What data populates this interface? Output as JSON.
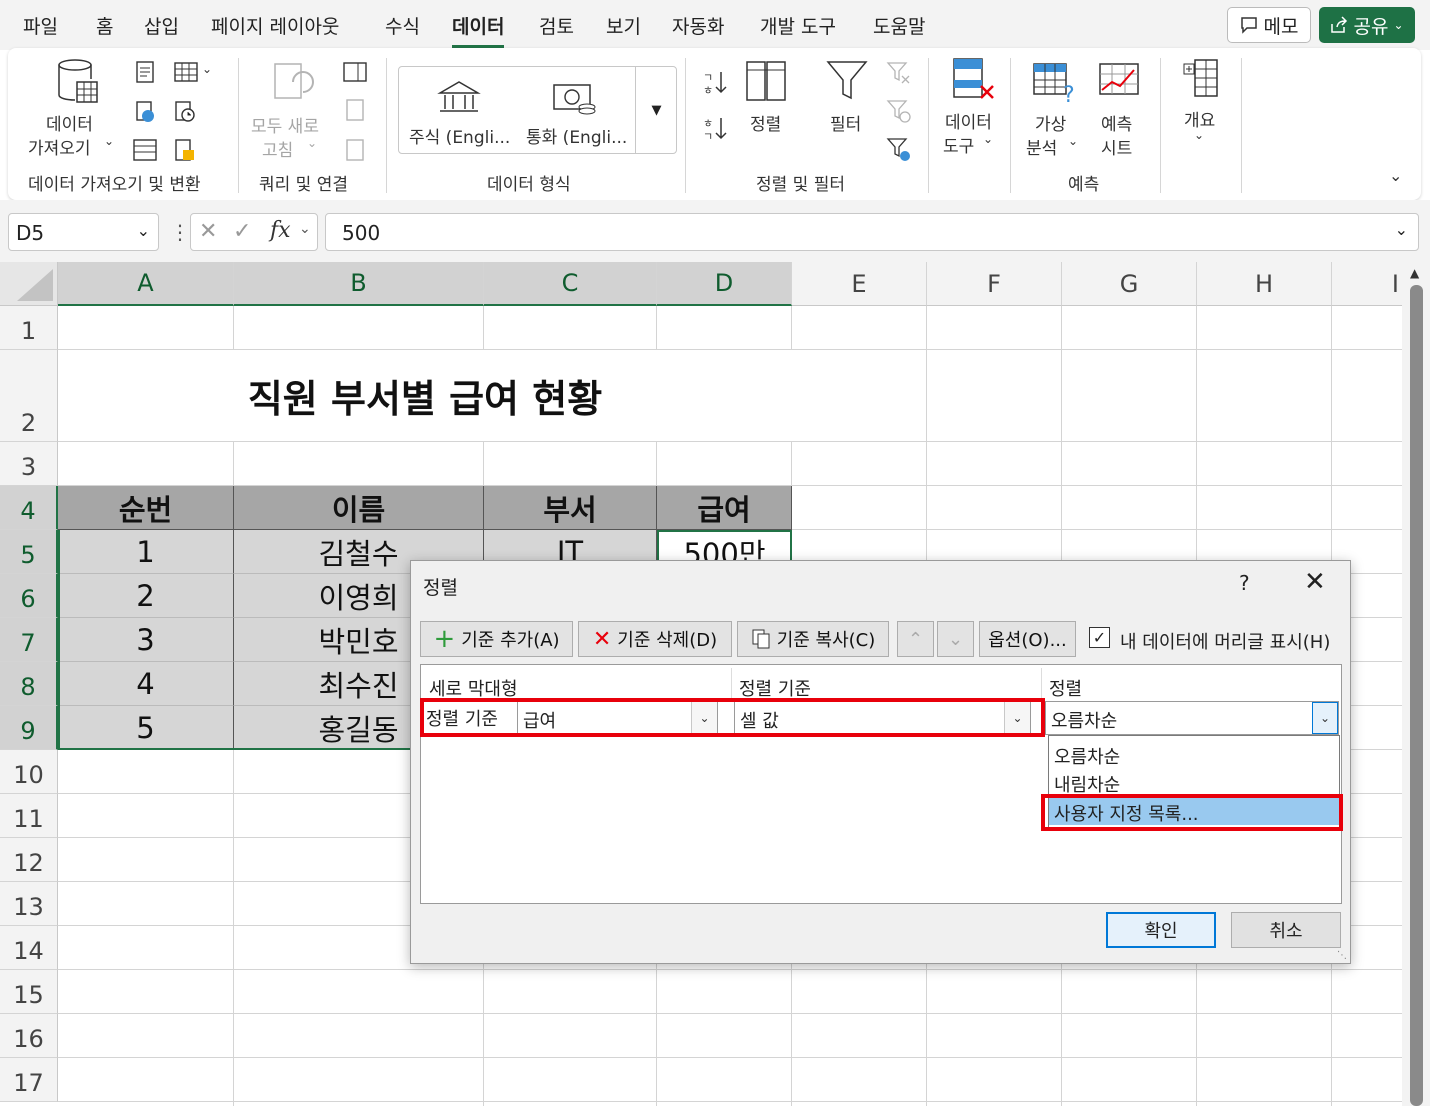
{
  "menu": {
    "tabs": [
      "파일",
      "홈",
      "삽입",
      "페이지 레이아웃",
      "수식",
      "데이터",
      "검토",
      "보기",
      "자동화",
      "개발 도구",
      "도움말"
    ],
    "active_index": 5,
    "memo_label": "메모",
    "share_label": "공유"
  },
  "ribbon": {
    "get_data_line1": "데이터",
    "get_data_line2": "가져오기",
    "group_get_transform": "데이터 가져오기 및 변환",
    "refresh_all_line1": "모두 새로",
    "refresh_all_line2": "고침",
    "group_queries": "쿼리 및 연결",
    "stocks_label": "주식 (Engli...",
    "currency_label": "통화 (Engli...",
    "group_data_types": "데이터 형식",
    "sort_label": "정렬",
    "filter_label": "필터",
    "group_sort_filter": "정렬 및 필터",
    "data_tools_line1": "데이터",
    "data_tools_line2": "도구",
    "what_if_line1": "가상",
    "what_if_line2": "분석",
    "forecast_sheet_line1": "예측",
    "forecast_sheet_line2": "시트",
    "group_forecast": "예측",
    "outline_label": "개요"
  },
  "formula_bar": {
    "name_box": "D5",
    "formula": "500"
  },
  "sheet": {
    "columns": [
      "A",
      "B",
      "C",
      "D",
      "E",
      "F",
      "G",
      "H",
      "I"
    ],
    "rows": [
      "1",
      "2",
      "3",
      "4",
      "5",
      "6",
      "7",
      "8",
      "9",
      "10",
      "11",
      "12",
      "13",
      "14",
      "15",
      "16",
      "17"
    ],
    "title": "직원 부서별 급여 현황",
    "table_headers": [
      "순번",
      "이름",
      "부서",
      "급여"
    ],
    "table_rows": [
      [
        "1",
        "김철수",
        "IT",
        "500만"
      ],
      [
        "2",
        "이영희",
        "",
        ""
      ],
      [
        "3",
        "박민호",
        "",
        ""
      ],
      [
        "4",
        "최수진",
        "",
        ""
      ],
      [
        "5",
        "홍길동",
        "",
        ""
      ]
    ]
  },
  "dialog": {
    "title": "정렬",
    "help": "?",
    "add_level": "기준 추가(A)",
    "delete_level": "기준 삭제(D)",
    "copy_level": "기준 복사(C)",
    "options": "옵션(O)...",
    "headers_checkbox": "내 데이터에 머리글 표시(H)",
    "headers_checked": true,
    "column_header": "세로 막대형",
    "sort_on_header": "정렬 기준",
    "order_header": "정렬",
    "level_label": "정렬 기준",
    "column_value": "급여",
    "sort_on_value": "셀 값",
    "order_value": "오름차순",
    "order_options": [
      "오름차순",
      "내림차순",
      "사용자 지정 목록..."
    ],
    "highlighted_option_index": 2,
    "ok": "확인",
    "cancel": "취소"
  },
  "colors": {
    "accent_green": "#217346",
    "highlight_red": "#e8000b",
    "selection_blue": "#99c9ef",
    "table_header_gray": "#a6a6a6",
    "table_body_gray": "#d6d6d6"
  }
}
